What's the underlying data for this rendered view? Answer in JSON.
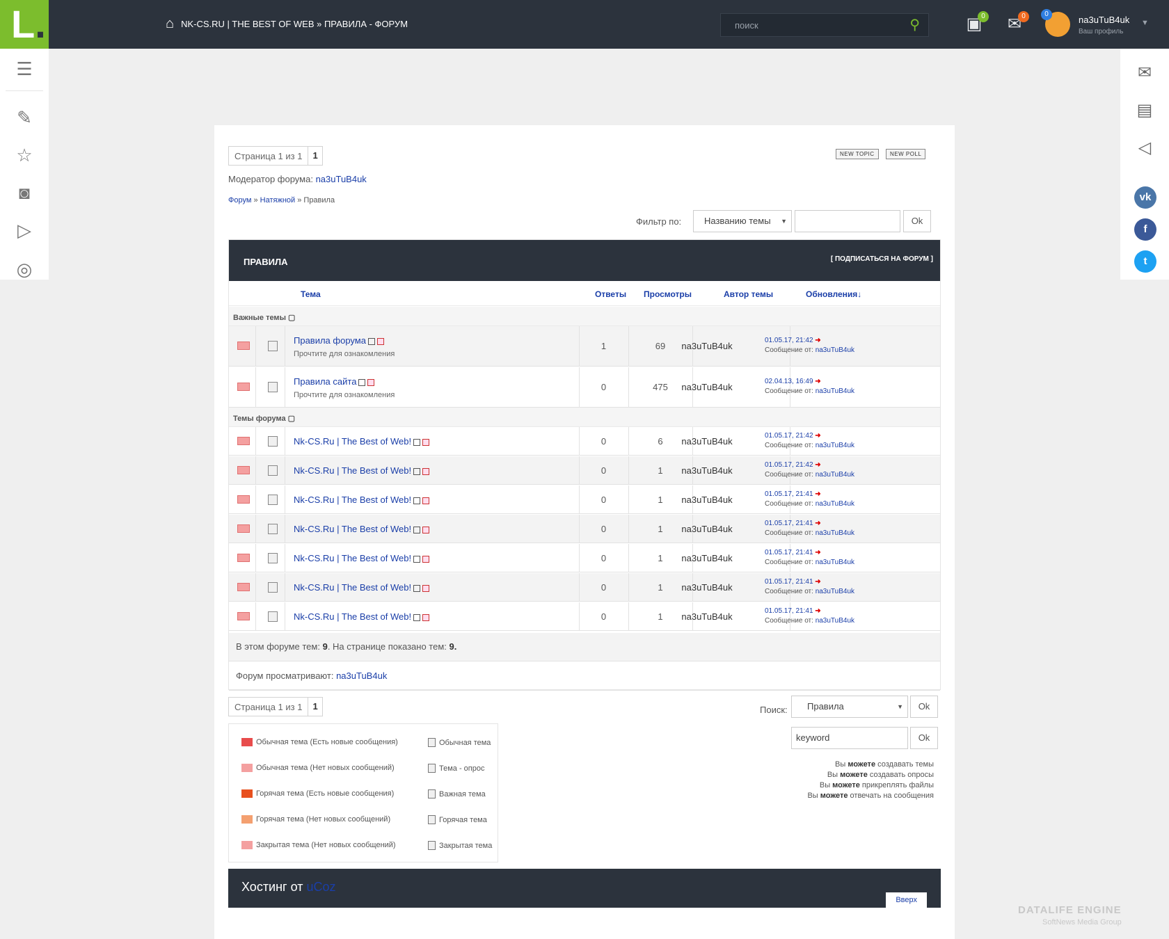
{
  "header": {
    "logo": "L",
    "breadcrumb": "NK-CS.RU | THE BEST OF WEB » ПРАВИЛА - ФОРУМ",
    "search_placeholder": "поиск",
    "gallery_count": "0",
    "messages_count": "0",
    "notif_count": "0",
    "username": "na3uTuB4uk",
    "profile_label": "Ваш профиль"
  },
  "pager_top": {
    "text": "Страница 1 из 1",
    "num": "1"
  },
  "buttons": {
    "new_topic": "NEW TOPIC",
    "new_poll": "NEW POLL"
  },
  "moderator": {
    "label": "Модератор форума:",
    "name": "na3uTuB4uk"
  },
  "path": {
    "forum": "Форум",
    "sep": " » ",
    "section": "Натяжной",
    "current": "Правила"
  },
  "filter": {
    "label": "Фильтр по:",
    "option": "Названию темы",
    "ok": "Ok"
  },
  "forum": {
    "title": "ПРАВИЛА",
    "subscribe": "[ ПОДПИСАТЬСЯ НА ФОРУМ ]",
    "columns": {
      "topic": "Тема",
      "replies": "Ответы",
      "views": "Просмотры",
      "author": "Автор темы",
      "updates": "Обновления↓"
    },
    "important_label": "Важные темы",
    "topics_label": "Темы форума",
    "important": [
      {
        "title": "Правила форума",
        "desc": "Прочтите для ознакомления",
        "replies": "1",
        "views": "69",
        "author": "na3uTuB4uk",
        "date": "01.05.17, 21:42",
        "by_label": "Сообщение от:",
        "by": "na3uTuB4uk"
      },
      {
        "title": "Правила сайта",
        "desc": "Прочтите для ознакомления",
        "replies": "0",
        "views": "475",
        "author": "na3uTuB4uk",
        "date": "02.04.13, 16:49",
        "by_label": "Сообщение от:",
        "by": "na3uTuB4uk"
      }
    ],
    "topics": [
      {
        "title": "Nk-CS.Ru | The Best of Web!",
        "replies": "0",
        "views": "6",
        "author": "na3uTuB4uk",
        "date": "01.05.17, 21:42",
        "by_label": "Сообщение от:",
        "by": "na3uTuB4uk"
      },
      {
        "title": "Nk-CS.Ru | The Best of Web!",
        "replies": "0",
        "views": "1",
        "author": "na3uTuB4uk",
        "date": "01.05.17, 21:42",
        "by_label": "Сообщение от:",
        "by": "na3uTuB4uk"
      },
      {
        "title": "Nk-CS.Ru | The Best of Web!",
        "replies": "0",
        "views": "1",
        "author": "na3uTuB4uk",
        "date": "01.05.17, 21:41",
        "by_label": "Сообщение от:",
        "by": "na3uTuB4uk"
      },
      {
        "title": "Nk-CS.Ru | The Best of Web!",
        "replies": "0",
        "views": "1",
        "author": "na3uTuB4uk",
        "date": "01.05.17, 21:41",
        "by_label": "Сообщение от:",
        "by": "na3uTuB4uk"
      },
      {
        "title": "Nk-CS.Ru | The Best of Web!",
        "replies": "0",
        "views": "1",
        "author": "na3uTuB4uk",
        "date": "01.05.17, 21:41",
        "by_label": "Сообщение от:",
        "by": "na3uTuB4uk"
      },
      {
        "title": "Nk-CS.Ru | The Best of Web!",
        "replies": "0",
        "views": "1",
        "author": "na3uTuB4uk",
        "date": "01.05.17, 21:41",
        "by_label": "Сообщение от:",
        "by": "na3uTuB4uk"
      },
      {
        "title": "Nk-CS.Ru | The Best of Web!",
        "replies": "0",
        "views": "1",
        "author": "na3uTuB4uk",
        "date": "01.05.17, 21:41",
        "by_label": "Сообщение от:",
        "by": "na3uTuB4uk"
      }
    ],
    "stats_a": "В этом форуме тем:",
    "stats_n1": "9",
    "stats_b": ". На странице показано тем:",
    "stats_n2": "9",
    "stats_c": ".",
    "viewers_label": "Форум просматривают:",
    "viewers": "na3uTuB4uk"
  },
  "pager_bottom": {
    "text": "Страница 1 из 1",
    "num": "1"
  },
  "jump": {
    "option": "Правила",
    "ok": "Ok"
  },
  "search": {
    "label": "Поиск:",
    "value": "keyword",
    "ok": "Ok"
  },
  "legend": [
    {
      "label": "Обычная тема (Есть новые сообщения)",
      "color": "#e84c4c"
    },
    {
      "label": "Обычная тема (Нет новых сообщений)",
      "color": "#f4a0a0"
    },
    {
      "label": "Горячая тема (Есть новые сообщения)",
      "color": "#e8501e"
    },
    {
      "label": "Горячая тема (Нет новых сообщений)",
      "color": "#f4a070"
    },
    {
      "label": "Закрытая тема (Нет новых сообщений)",
      "color": "#f4a0a0"
    }
  ],
  "legend_right": [
    "Обычная тема",
    "Тема - опрос",
    "Важная тема",
    "Горячая тема",
    "Закрытая тема"
  ],
  "permissions": [
    {
      "a": "Вы ",
      "b": "можете",
      "c": " создавать темы"
    },
    {
      "a": "Вы ",
      "b": "можете",
      "c": " создавать опросы"
    },
    {
      "a": "Вы ",
      "b": "можете",
      "c": " прикреплять файлы"
    },
    {
      "a": "Вы ",
      "b": "можете",
      "c": " отвечать на сообщения"
    }
  ],
  "footer": {
    "hosting": "Хостинг от ",
    "brand": "uCoz",
    "up": "Вверх"
  },
  "watermark": {
    "title": "DATALIFE ENGINE",
    "sub": "SoftNews Media Group"
  },
  "social": {
    "vk": "vk",
    "fb": "f",
    "tw": "t"
  },
  "colors": {
    "accent": "#7cbd2d",
    "dark": "#2c333d",
    "link": "#1a3ea8"
  }
}
